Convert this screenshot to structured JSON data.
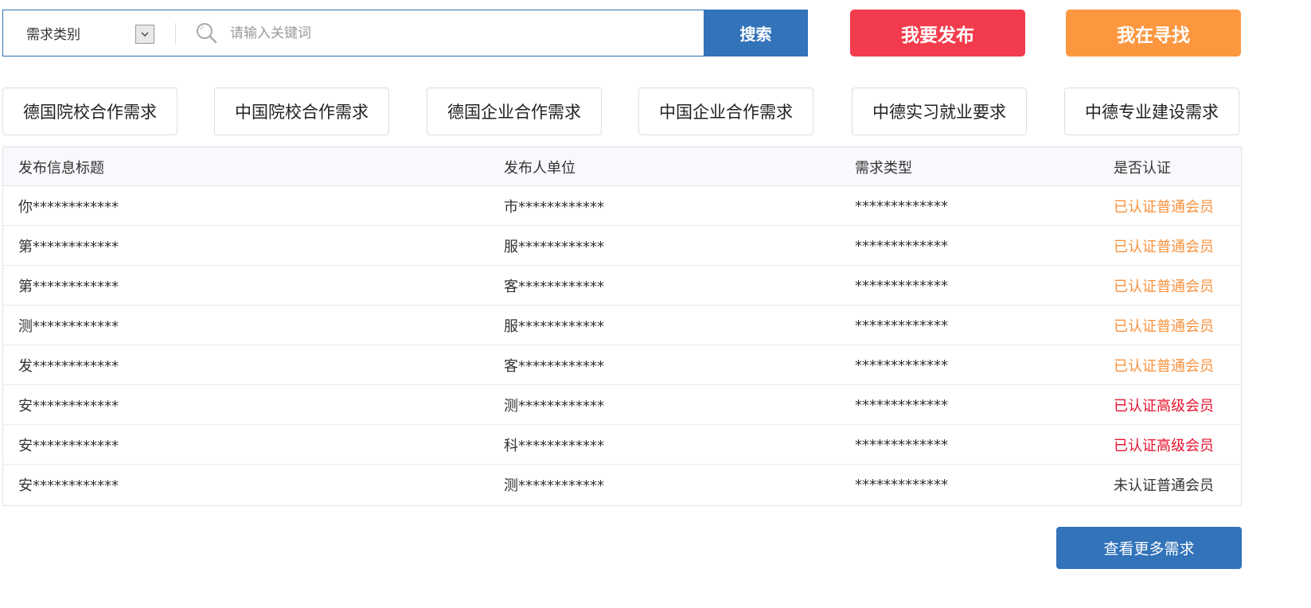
{
  "search": {
    "category_label": "需求类别",
    "placeholder": "请输入关键词",
    "button_label": "搜索"
  },
  "actions": {
    "publish_label": "我要发布",
    "seek_label": "我在寻找"
  },
  "colors": {
    "primary_blue": "#3273ba",
    "publish_red": "#f23c4e",
    "seek_orange": "#fc9740",
    "status_normal": "#f8913c",
    "status_premium": "#e8112d"
  },
  "categories": [
    "德国院校合作需求",
    "中国院校合作需求",
    "德国企业合作需求",
    "中国企业合作需求",
    "中德实习就业要求",
    "中德专业建设需求"
  ],
  "table": {
    "headers": [
      "发布信息标题",
      "发布人单位",
      "需求类型",
      "是否认证"
    ],
    "rows": [
      {
        "title": "你************",
        "org": "市************",
        "type": "*************",
        "status": "已认证普通会员",
        "level": "normal"
      },
      {
        "title": "第************",
        "org": "服************",
        "type": "*************",
        "status": "已认证普通会员",
        "level": "normal"
      },
      {
        "title": "第************",
        "org": "客************",
        "type": "*************",
        "status": "已认证普通会员",
        "level": "normal"
      },
      {
        "title": "测************",
        "org": "服************",
        "type": "*************",
        "status": "已认证普通会员",
        "level": "normal"
      },
      {
        "title": "发************",
        "org": "客************",
        "type": "*************",
        "status": "已认证普通会员",
        "level": "normal"
      },
      {
        "title": "安************",
        "org": "测************",
        "type": "*************",
        "status": "已认证高级会员",
        "level": "premium"
      },
      {
        "title": "安************",
        "org": "科************",
        "type": "*************",
        "status": "已认证高级会员",
        "level": "premium"
      },
      {
        "title": "安************",
        "org": "测************",
        "type": "*************",
        "status": "未认证普通会员",
        "level": "unverified"
      }
    ]
  },
  "more_label": "查看更多需求"
}
